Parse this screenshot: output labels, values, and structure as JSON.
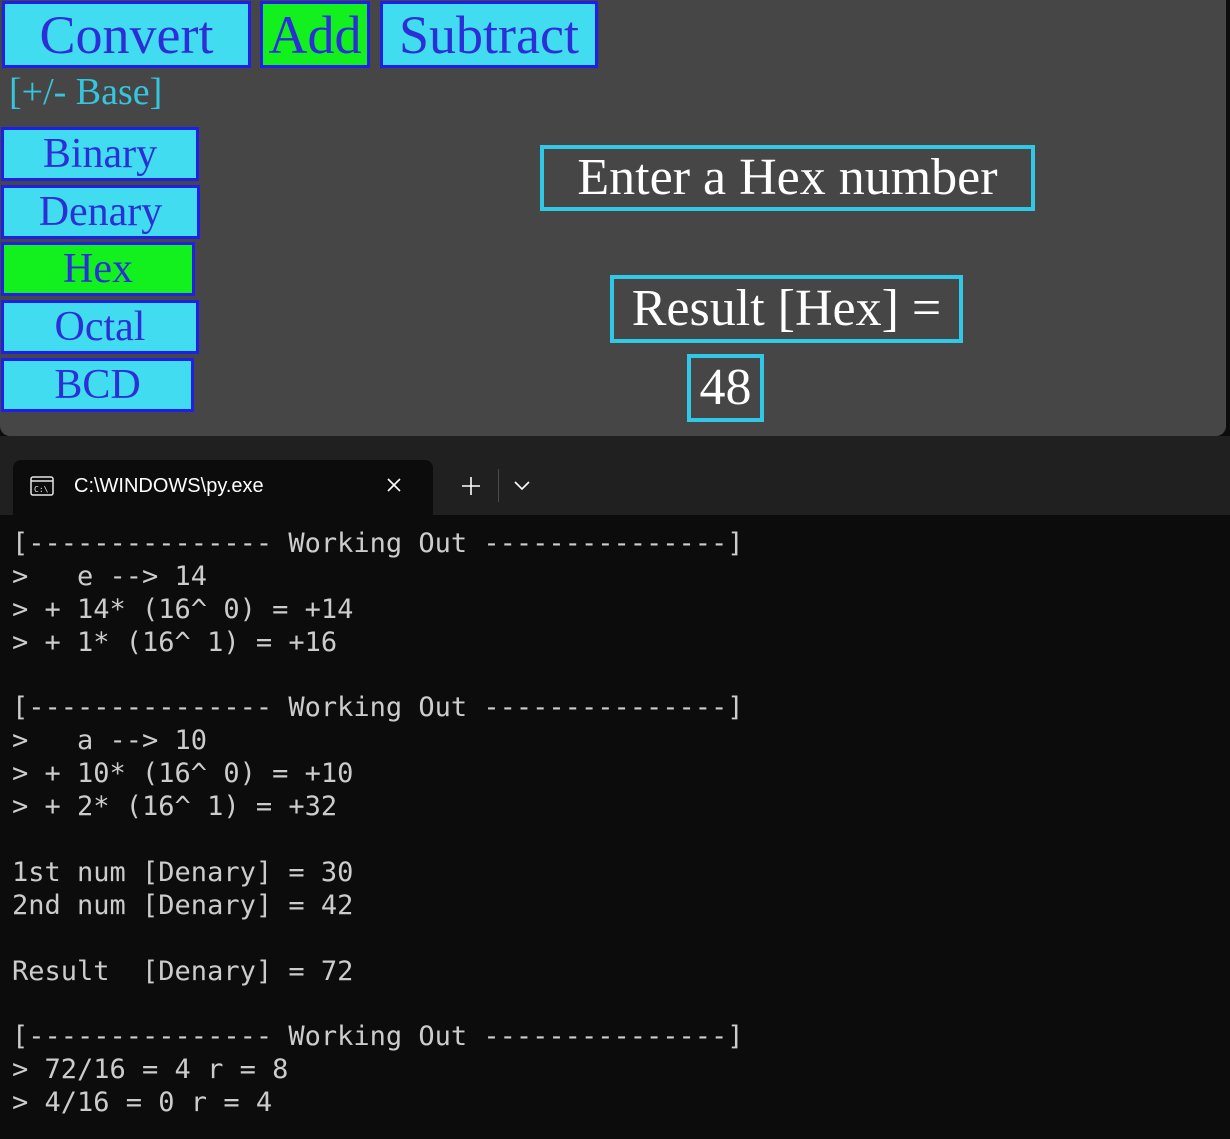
{
  "app": {
    "top_buttons": [
      {
        "label": "Convert",
        "active": false
      },
      {
        "label": "Add",
        "active": true
      },
      {
        "label": "Subtract",
        "active": false
      }
    ],
    "base_toggle_label": "[+/-  Base]",
    "base_buttons": [
      {
        "label": "Binary",
        "active": false
      },
      {
        "label": "Denary",
        "active": false
      },
      {
        "label": "Hex",
        "active": true
      },
      {
        "label": "Octal",
        "active": false
      },
      {
        "label": "BCD",
        "active": false
      }
    ],
    "prompt_text": "Enter a Hex number",
    "result_label": "Result [Hex] =",
    "result_value": "48",
    "colors": {
      "background": "#464646",
      "button_fill": "#41dcf0",
      "button_active": "#12f01e",
      "button_border": "#1f1fe6",
      "box_border": "#30c8e6"
    }
  },
  "terminal": {
    "tab_title": "C:\\WINDOWS\\py.exe",
    "tab_icon": "console-icon",
    "lines": [
      "[--------------- Working Out ---------------]",
      ">   e --> 14",
      "> + 14* (16^ 0) = +14",
      "> + 1* (16^ 1) = +16",
      "",
      "[--------------- Working Out ---------------]",
      ">   a --> 10",
      "> + 10* (16^ 0) = +10",
      "> + 2* (16^ 1) = +32",
      "",
      "1st num [Denary] = 30",
      "2nd num [Denary] = 42",
      "",
      "Result  [Denary] = 72",
      "",
      "[--------------- Working Out ---------------]",
      "> 72/16 = 4 r = 8",
      "> 4/16 = 0 r = 4"
    ]
  }
}
